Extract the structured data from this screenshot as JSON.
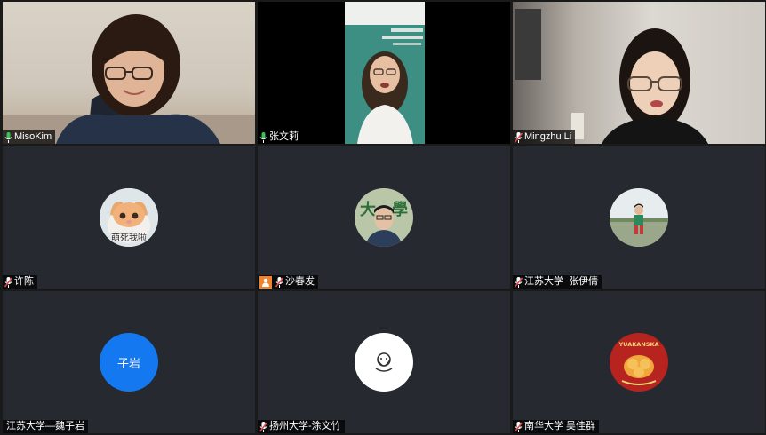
{
  "participants": [
    {
      "name": "MisoKim",
      "mic": "on",
      "type": "video"
    },
    {
      "name": "张文莉",
      "mic": "on",
      "type": "video",
      "active_speaker": true
    },
    {
      "name": "Mingzhu Li",
      "mic": "muted",
      "type": "video"
    },
    {
      "name": "许陈",
      "mic": "muted",
      "type": "avatar",
      "avatar_caption": "萌死我啦"
    },
    {
      "name": "沙春发",
      "mic": "muted",
      "type": "avatar",
      "host_badge": "person-icon"
    },
    {
      "name": "江苏大学  张伊倩",
      "mic": "muted",
      "type": "avatar"
    },
    {
      "name": "江苏大学—魏子岩",
      "mic": "none",
      "type": "initials",
      "initials": "子岩"
    },
    {
      "name": "扬州大学-涂文竹",
      "mic": "muted",
      "type": "avatar"
    },
    {
      "name": "南华大学 吴佳群",
      "mic": "muted",
      "type": "avatar",
      "avatar_text": "YUAKANSKA"
    }
  ],
  "colors": {
    "tile_bg": "#262a30",
    "active_border": "#3ec15b",
    "mic_on": "#3ec15b",
    "mic_muted": "#e04848",
    "initials_bg": "#1478f0",
    "host_badge": "#f0832b"
  }
}
